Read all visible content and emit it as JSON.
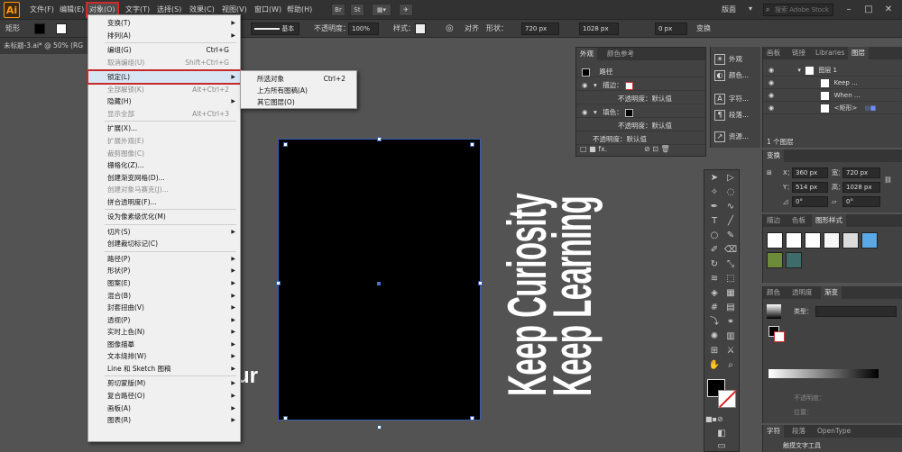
{
  "menubar": {
    "logo": "Ai",
    "items": [
      "文件(F)",
      "编辑(E)",
      "对象(O)",
      "文字(T)",
      "选择(S)",
      "效果(C)",
      "视图(V)",
      "窗口(W)",
      "帮助(H)"
    ],
    "buttons": [
      "Br",
      "St"
    ],
    "workspace": "版面",
    "search_placeholder": "搜索 Adobe Stock",
    "window_controls": [
      "–",
      "□",
      "✕"
    ]
  },
  "controlbar": {
    "selection_type": "矩形",
    "stroke_style": "基本",
    "opacity_label": "不透明度：",
    "opacity_value": "100%",
    "style_label": "样式：",
    "align_label": "对齐",
    "shape_label": "形状：",
    "width_value": "720 px",
    "height_value": "1028 px",
    "corner_value": "0 px",
    "transform_label": "变换"
  },
  "document": {
    "tab_title": "未标题-3.ai* @ 50% (RG"
  },
  "object_menu": {
    "items": [
      {
        "label": "变换(T)",
        "shortcut": "",
        "submenu": true,
        "disabled": false
      },
      {
        "label": "排列(A)",
        "shortcut": "",
        "submenu": true,
        "disabled": false
      },
      {
        "label": "编组(G)",
        "shortcut": "Ctrl+G",
        "submenu": false,
        "disabled": false
      },
      {
        "label": "取消编组(U)",
        "shortcut": "Shift+Ctrl+G",
        "submenu": false,
        "disabled": true
      },
      {
        "label": "锁定(L)",
        "shortcut": "",
        "submenu": true,
        "disabled": false,
        "highlighted": true
      },
      {
        "label": "全部解锁(K)",
        "shortcut": "Alt+Ctrl+2",
        "submenu": false,
        "disabled": true
      },
      {
        "label": "隐藏(H)",
        "shortcut": "",
        "submenu": true,
        "disabled": false
      },
      {
        "label": "显示全部",
        "shortcut": "Alt+Ctrl+3",
        "submenu": false,
        "disabled": true
      },
      {
        "label": "扩展(X)...",
        "shortcut": "",
        "submenu": false,
        "disabled": false
      },
      {
        "label": "扩展外观(E)",
        "shortcut": "",
        "submenu": false,
        "disabled": true
      },
      {
        "label": "裁剪图像(C)",
        "shortcut": "",
        "submenu": false,
        "disabled": true
      },
      {
        "label": "栅格化(Z)...",
        "shortcut": "",
        "submenu": false,
        "disabled": false
      },
      {
        "label": "创建渐变网格(D)...",
        "shortcut": "",
        "submenu": false,
        "disabled": false
      },
      {
        "label": "创建对象马赛克(J)...",
        "shortcut": "",
        "submenu": false,
        "disabled": true
      },
      {
        "label": "拼合透明度(F)...",
        "shortcut": "",
        "submenu": false,
        "disabled": false
      },
      {
        "label": "设为像素级优化(M)",
        "shortcut": "",
        "submenu": false,
        "disabled": false
      },
      {
        "label": "切片(S)",
        "shortcut": "",
        "submenu": true,
        "disabled": false
      },
      {
        "label": "创建裁切标记(C)",
        "shortcut": "",
        "submenu": false,
        "disabled": false
      },
      {
        "label": "路径(P)",
        "shortcut": "",
        "submenu": true,
        "disabled": false
      },
      {
        "label": "形状(P)",
        "shortcut": "",
        "submenu": true,
        "disabled": false
      },
      {
        "label": "图案(E)",
        "shortcut": "",
        "submenu": true,
        "disabled": false
      },
      {
        "label": "混合(B)",
        "shortcut": "",
        "submenu": true,
        "disabled": false
      },
      {
        "label": "封套扭曲(V)",
        "shortcut": "",
        "submenu": true,
        "disabled": false
      },
      {
        "label": "透视(P)",
        "shortcut": "",
        "submenu": true,
        "disabled": false
      },
      {
        "label": "实时上色(N)",
        "shortcut": "",
        "submenu": true,
        "disabled": false
      },
      {
        "label": "图像描摹",
        "shortcut": "",
        "submenu": true,
        "disabled": false
      },
      {
        "label": "文本绕排(W)",
        "shortcut": "",
        "submenu": true,
        "disabled": false
      },
      {
        "label": "Line 和 Sketch 图稿",
        "shortcut": "",
        "submenu": true,
        "disabled": false
      },
      {
        "label": "剪切蒙版(M)",
        "shortcut": "",
        "submenu": true,
        "disabled": false
      },
      {
        "label": "复合路径(O)",
        "shortcut": "",
        "submenu": true,
        "disabled": false
      },
      {
        "label": "画板(A)",
        "shortcut": "",
        "submenu": true,
        "disabled": false
      },
      {
        "label": "图表(R)",
        "shortcut": "",
        "submenu": true,
        "disabled": false
      }
    ]
  },
  "lock_submenu": {
    "items": [
      {
        "label": "所选对象",
        "shortcut": "Ctrl+2"
      },
      {
        "label": "上方所有图稿(A)",
        "shortcut": ""
      },
      {
        "label": "其它图层(O)",
        "shortcut": ""
      }
    ]
  },
  "canvas": {
    "line1": "Keep Curiosity",
    "line2": "Keep Learning",
    "partial_word": "ur"
  },
  "appearance_panel": {
    "tabs": [
      "外观",
      "颜色参考"
    ],
    "object_type": "路径",
    "stroke_label": "描边：",
    "opacity_row": "不透明度：默认值",
    "fill_label": "填色：",
    "opacity_row2": "不透明度：默认值",
    "opacity_row3": "不透明度：默认值"
  },
  "dock": {
    "items": [
      "外观",
      "颜色...",
      "字符...",
      "段落...",
      "资源..."
    ]
  },
  "layers_panel": {
    "tabs": [
      "画板",
      "链接",
      "Libraries",
      "图层"
    ],
    "rows": [
      "图层 1",
      "Keep ...",
      "When ...",
      "<矩形>"
    ],
    "footer": "1 个图层"
  },
  "transform_panel": {
    "title": "变换",
    "x_label": "X：",
    "x_value": "360 px",
    "y_label": "Y：",
    "y_value": "514 px",
    "w_label": "宽：",
    "w_value": "720 px",
    "h_label": "高：",
    "h_value": "1028 px",
    "rot_value": "0°",
    "shear_value": "0°"
  },
  "styles_panel": {
    "tabs": [
      "描边",
      "色板",
      "图形样式"
    ]
  },
  "gradient_panel": {
    "tabs": [
      "颜色",
      "透明度",
      "渐变"
    ],
    "type_label": "类型：",
    "opacity_label": "不透明度：",
    "position_label": "位置："
  },
  "character_panel": {
    "tabs": [
      "字符",
      "段落",
      "OpenType"
    ],
    "tool_hint": "触摸文字工具"
  }
}
